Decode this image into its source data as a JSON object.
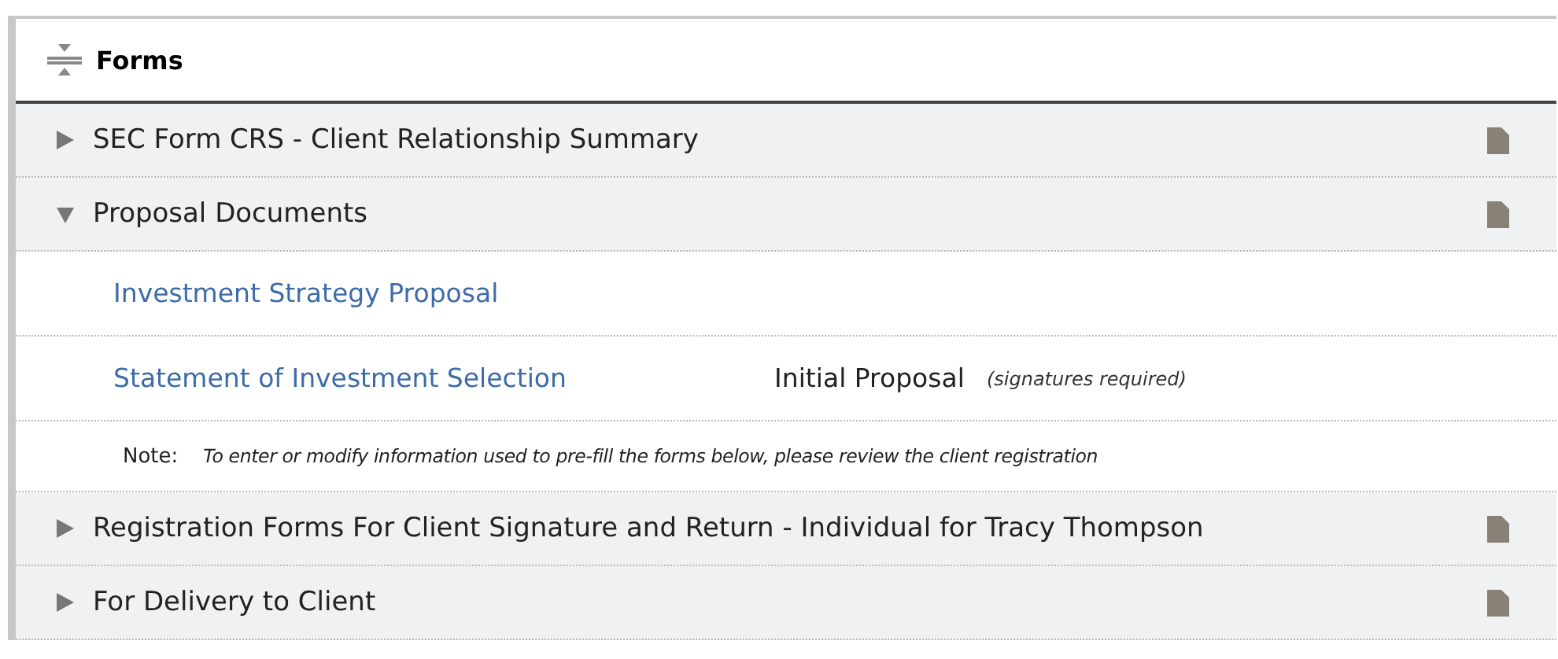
{
  "panel": {
    "title": "Forms"
  },
  "sections": [
    {
      "title": "SEC Form CRS - Client Relationship Summary",
      "expanded": false
    },
    {
      "title": "Proposal Documents",
      "expanded": true,
      "documents": [
        {
          "name": "Investment Strategy Proposal"
        },
        {
          "name": "Statement of Investment Selection",
          "status": "Initial Proposal",
          "status_note": "(signatures required)"
        }
      ],
      "note": {
        "label": "Note:",
        "text": "To enter or modify information used to pre-fill the forms below, please review the client registration"
      }
    },
    {
      "title": "Registration Forms For Client Signature and Return - Individual for Tracy Thompson",
      "expanded": false
    },
    {
      "title": "For Delivery to Client",
      "expanded": false
    }
  ]
}
